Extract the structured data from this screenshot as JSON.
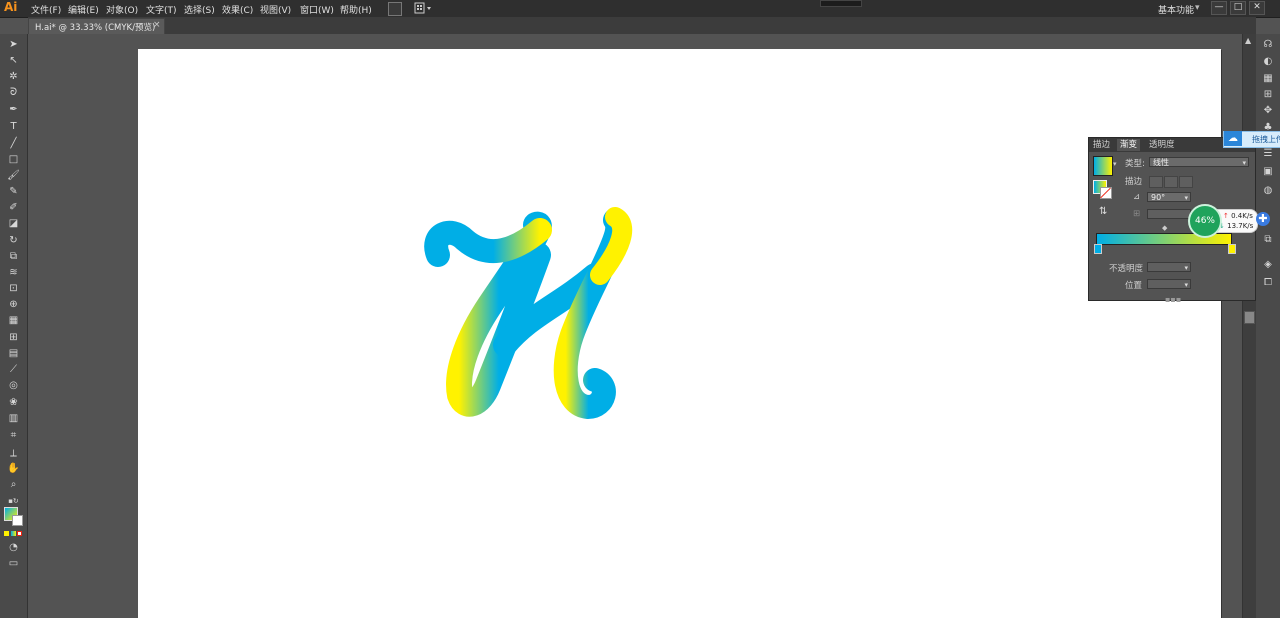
{
  "app": {
    "logo": "Ai"
  },
  "menu": {
    "items": [
      "文件(F)",
      "编辑(E)",
      "对象(O)",
      "文字(T)",
      "选择(S)",
      "效果(C)",
      "视图(V)",
      "窗口(W)",
      "帮助(H)"
    ],
    "workspace": "基本功能"
  },
  "window": {
    "min": "—",
    "max": "□",
    "close": "✕"
  },
  "document": {
    "tab_label": "H.ai* @ 33.33% (CMYK/预览)",
    "close": "×"
  },
  "tools": [
    "selection-tool",
    "direct-selection-tool",
    "magic-wand-tool",
    "lasso-tool",
    "pen-tool",
    "type-tool",
    "line-tool",
    "rectangle-tool",
    "paintbrush-tool",
    "pencil-tool",
    "blob-brush-tool",
    "eraser-tool",
    "rotate-tool",
    "scale-tool",
    "width-tool",
    "free-transform-tool",
    "shape-builder-tool",
    "perspective-grid-tool",
    "mesh-tool",
    "gradient-tool",
    "eyedropper-tool",
    "blend-tool",
    "symbol-sprayer-tool",
    "column-graph-tool",
    "artboard-tool",
    "slice-tool",
    "hand-tool",
    "zoom-tool"
  ],
  "gradient_panel": {
    "tabs": [
      "描边",
      "渐变",
      "透明度"
    ],
    "type_label": "类型:",
    "type_value": "线性",
    "stroke_label": "描边",
    "angle_value": "90°",
    "opacity_label": "不透明度",
    "location_label": "位置",
    "colors": {
      "start": "#00aee6",
      "end": "#fff200"
    }
  },
  "net_speed": {
    "percent": "46%",
    "up": "0.4K/s",
    "down": "13.7K/s"
  },
  "upload_tip": {
    "label": "拖拽上传"
  }
}
